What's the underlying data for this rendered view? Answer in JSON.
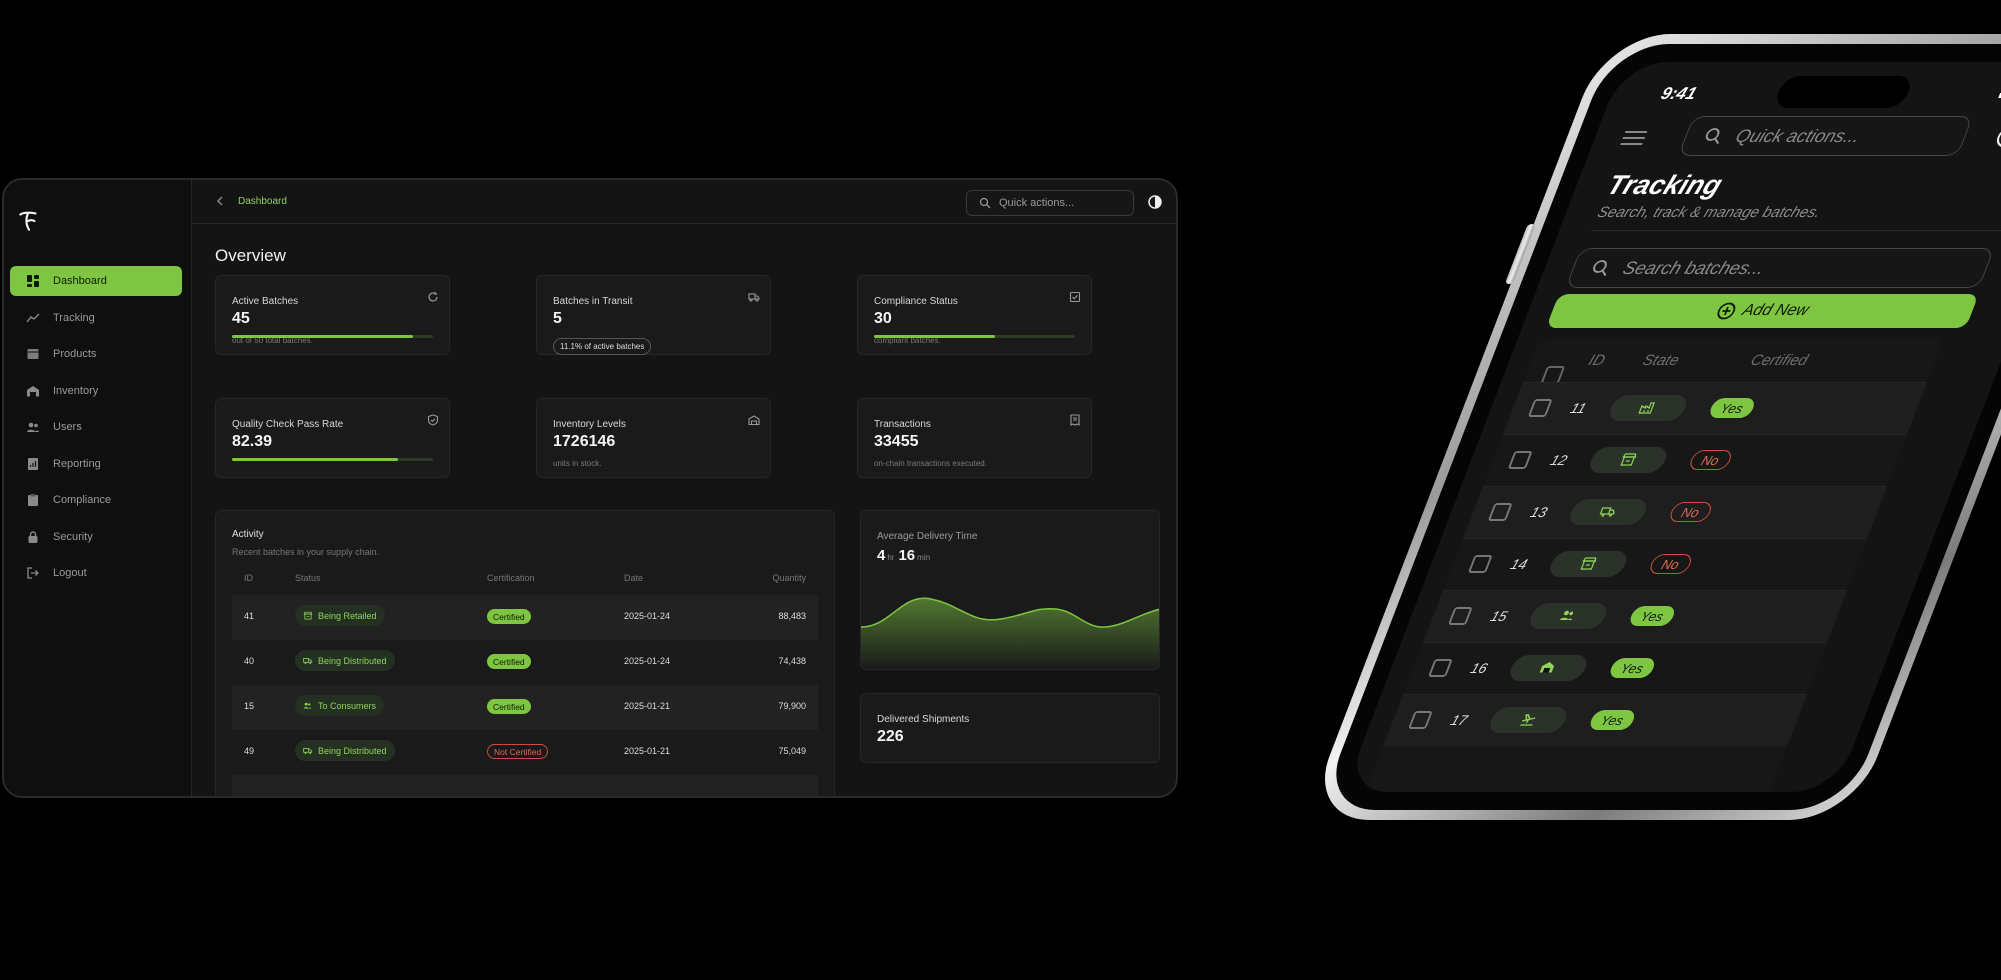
{
  "desktop": {
    "breadcrumb": "Dashboard",
    "search_placeholder": "Quick actions...",
    "page_title": "Overview",
    "nav": [
      {
        "label": "Dashboard",
        "icon": "grid-icon",
        "active": true
      },
      {
        "label": "Tracking",
        "icon": "chart-line-icon"
      },
      {
        "label": "Products",
        "icon": "box-icon"
      },
      {
        "label": "Inventory",
        "icon": "warehouse-icon"
      },
      {
        "label": "Users",
        "icon": "users-icon"
      },
      {
        "label": "Reporting",
        "icon": "report-icon"
      },
      {
        "label": "Compliance",
        "icon": "clipboard-icon"
      },
      {
        "label": "Security",
        "icon": "lock-icon"
      },
      {
        "label": "Logout",
        "icon": "logout-icon"
      }
    ],
    "cards": {
      "active_batches": {
        "title": "Active Batches",
        "value": "45",
        "sub": "out of 50 total batches.",
        "progress": 0.9
      },
      "in_transit": {
        "title": "Batches in Transit",
        "value": "5",
        "pill": "11.1% of active batches"
      },
      "compliance": {
        "title": "Compliance Status",
        "value": "30",
        "sub": "compliant batches.",
        "progress": 0.6
      },
      "quality": {
        "title": "Quality Check Pass Rate",
        "value": "82.39",
        "progress": 0.8239
      },
      "inventory": {
        "title": "Inventory Levels",
        "value": "1726146",
        "sub": "units in stock."
      },
      "transactions": {
        "title": "Transactions",
        "value": "33455",
        "sub": "on-chain transactions executed."
      }
    },
    "activity": {
      "title": "Activity",
      "subtitle": "Recent batches in your supply chain.",
      "columns": [
        "ID",
        "Status",
        "Certification",
        "Date",
        "Quantity"
      ],
      "rows": [
        {
          "id": "41",
          "status": "Being Retailed",
          "status_icon": "store-icon",
          "cert": "Certified",
          "cert_ok": true,
          "date": "2025-01-24",
          "qty": "88,483"
        },
        {
          "id": "40",
          "status": "Being Distributed",
          "status_icon": "truck-icon",
          "cert": "Certified",
          "cert_ok": true,
          "date": "2025-01-24",
          "qty": "74,438"
        },
        {
          "id": "15",
          "status": "To Consumers",
          "status_icon": "users-icon",
          "cert": "Certified",
          "cert_ok": true,
          "date": "2025-01-21",
          "qty": "79,900"
        },
        {
          "id": "49",
          "status": "Being Distributed",
          "status_icon": "truck-icon",
          "cert": "Not Certified",
          "cert_ok": false,
          "date": "2025-01-21",
          "qty": "75,049"
        }
      ]
    },
    "delivery": {
      "title": "Average Delivery Time",
      "hours": "4",
      "hours_unit": "hr",
      "minutes": "16",
      "minutes_unit": "min"
    },
    "shipments": {
      "title": "Delivered Shipments",
      "value": "226"
    }
  },
  "phone": {
    "time": "9:41",
    "quick_placeholder": "Quick actions...",
    "title": "Tracking",
    "subtitle": "Search, track & manage batches.",
    "search_placeholder": "Search batches...",
    "add_label": "Add New",
    "columns": [
      "ID",
      "State",
      "Certified"
    ],
    "rows": [
      {
        "id": "11",
        "state_icon": "factory-icon",
        "certified": "Yes"
      },
      {
        "id": "12",
        "state_icon": "store-icon",
        "certified": "No"
      },
      {
        "id": "13",
        "state_icon": "truck-icon",
        "certified": "No"
      },
      {
        "id": "14",
        "state_icon": "store-icon",
        "certified": "No"
      },
      {
        "id": "15",
        "state_icon": "users-icon",
        "certified": "Yes"
      },
      {
        "id": "16",
        "state_icon": "warehouse-icon",
        "certified": "Yes"
      },
      {
        "id": "17",
        "state_icon": "plane-icon",
        "certified": "Yes"
      }
    ]
  },
  "colors": {
    "accent": "#7ec642",
    "danger": "#e06a52",
    "bg": "#141414"
  }
}
